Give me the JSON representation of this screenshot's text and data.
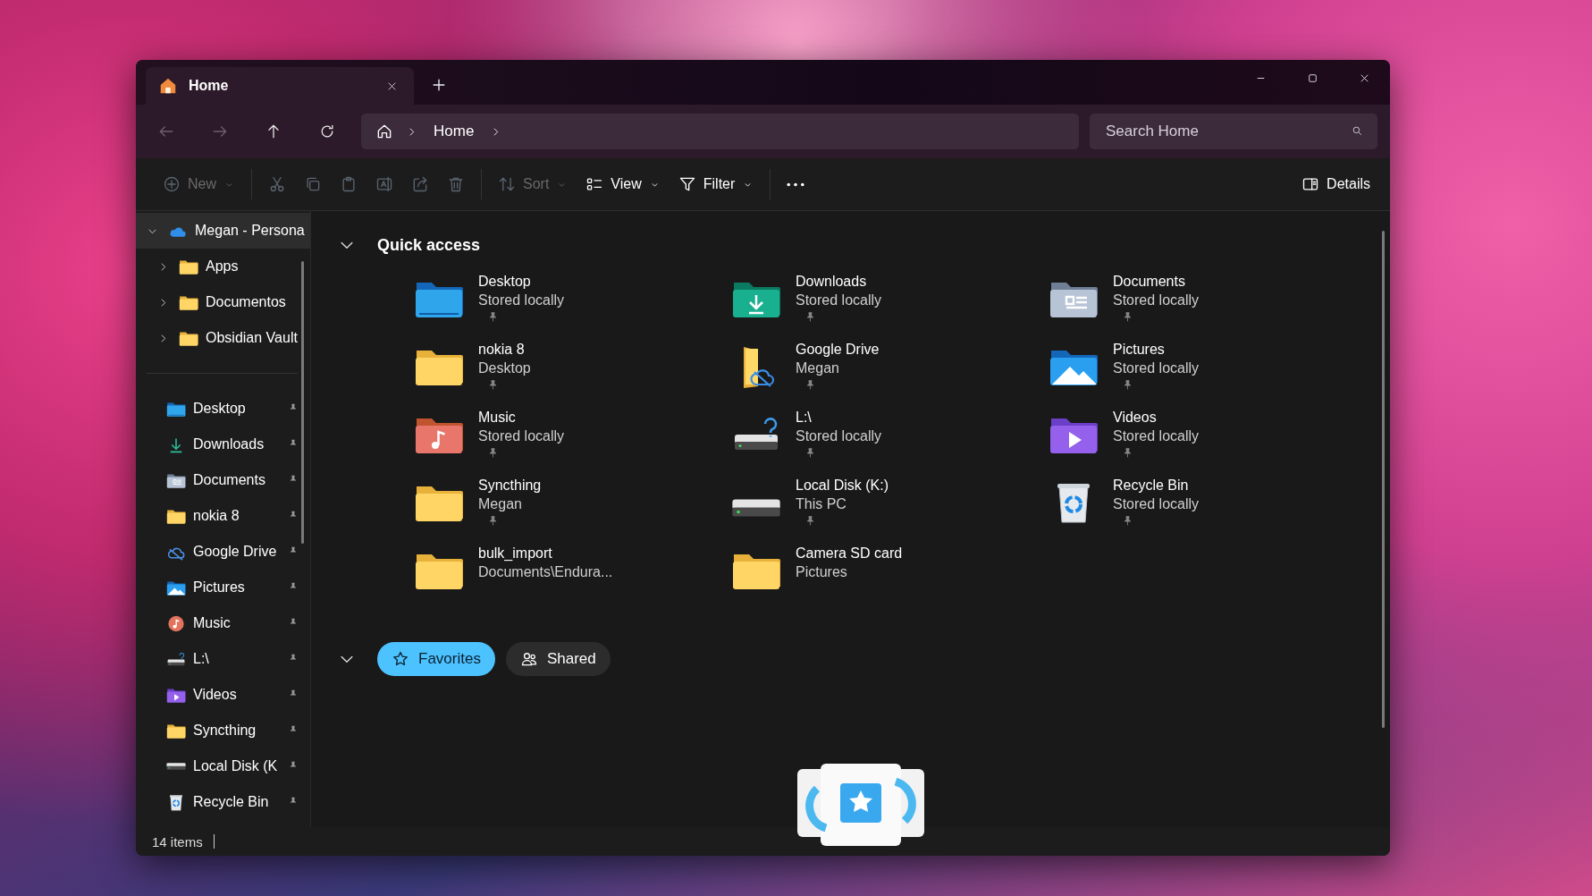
{
  "tabs": [
    {
      "title": "Home",
      "selected": true
    }
  ],
  "nav": [
    {
      "kind": "back",
      "disabled": true
    },
    {
      "kind": "forward",
      "disabled": true
    },
    {
      "kind": "up",
      "disabled": false
    },
    {
      "kind": "refresh",
      "disabled": false
    }
  ],
  "address_bar": {
    "crumbs": [
      "Home"
    ]
  },
  "search": {
    "placeholder": "Search Home"
  },
  "toolbar": {
    "items": [
      {
        "kind": "new",
        "label": "New",
        "disabled": true,
        "dropdown": true
      },
      {
        "kind": "cut",
        "disabled": true
      },
      {
        "kind": "copy",
        "disabled": true
      },
      {
        "kind": "paste",
        "disabled": true
      },
      {
        "kind": "rename",
        "disabled": true
      },
      {
        "kind": "share",
        "disabled": true
      },
      {
        "kind": "delete",
        "disabled": true
      },
      {
        "kind": "sort",
        "label": "Sort",
        "disabled": true,
        "dropdown": true
      },
      {
        "kind": "view",
        "label": "View",
        "disabled": false,
        "dropdown": true
      },
      {
        "kind": "filter",
        "label": "Filter",
        "disabled": false,
        "dropdown": true
      },
      {
        "kind": "more",
        "disabled": false
      }
    ],
    "details_button": {
      "label": "Details"
    }
  },
  "sidebar": {
    "tree": [
      {
        "label": "Megan - Persona",
        "kind": "cloud",
        "expanded": true,
        "selected": true,
        "children": [
          {
            "label": "Apps",
            "kind": "folder",
            "expanded": false,
            "selected": false
          },
          {
            "label": "Documentos",
            "kind": "folder",
            "expanded": false,
            "selected": false
          },
          {
            "label": "Obsidian Vault",
            "kind": "folder",
            "expanded": false,
            "selected": false
          }
        ]
      }
    ],
    "pinned": [
      {
        "label": "Desktop",
        "kind": "desktop"
      },
      {
        "label": "Downloads",
        "kind": "download-arrow"
      },
      {
        "label": "Documents",
        "kind": "documents"
      },
      {
        "label": "nokia 8",
        "kind": "folder"
      },
      {
        "label": "Google Drive",
        "kind": "cloud-outline"
      },
      {
        "label": "Pictures",
        "kind": "pictures"
      },
      {
        "label": "Music",
        "kind": "music-disc"
      },
      {
        "label": "L:\\",
        "kind": "drive-unknown"
      },
      {
        "label": "Videos",
        "kind": "videos"
      },
      {
        "label": "Syncthing",
        "kind": "folder"
      },
      {
        "label": "Local Disk (K",
        "kind": "drive"
      },
      {
        "label": "Recycle Bin",
        "kind": "recycle"
      }
    ]
  },
  "quick_access": {
    "title": "Quick access",
    "expanded": true,
    "items": [
      {
        "name": "Desktop",
        "location": "Stored locally",
        "kind": "desktop",
        "pinned": true
      },
      {
        "name": "Downloads",
        "location": "Stored locally",
        "kind": "downloads",
        "pinned": true
      },
      {
        "name": "Documents",
        "location": "Stored locally",
        "kind": "documents",
        "pinned": true
      },
      {
        "name": "nokia 8",
        "location": "Desktop",
        "kind": "folder",
        "pinned": true
      },
      {
        "name": "Google Drive",
        "location": "Megan",
        "kind": "cloud-folder",
        "pinned": true
      },
      {
        "name": "Pictures",
        "location": "Stored locally",
        "kind": "pictures",
        "pinned": true
      },
      {
        "name": "Music",
        "location": "Stored locally",
        "kind": "music",
        "pinned": true
      },
      {
        "name": "L:\\",
        "location": "Stored locally",
        "kind": "drive-unknown",
        "pinned": true
      },
      {
        "name": "Videos",
        "location": "Stored locally",
        "kind": "videos",
        "pinned": true
      },
      {
        "name": "Syncthing",
        "location": "Megan",
        "kind": "folder",
        "pinned": true
      },
      {
        "name": "Local Disk (K:)",
        "location": "This PC",
        "kind": "drive",
        "pinned": true
      },
      {
        "name": "Recycle Bin",
        "location": "Stored locally",
        "kind": "recycle",
        "pinned": true
      },
      {
        "name": "bulk_import",
        "location": "Documents\\Endura...",
        "kind": "folder",
        "pinned": false
      },
      {
        "name": "Camera SD card",
        "location": "Pictures",
        "kind": "folder",
        "pinned": false
      }
    ]
  },
  "favorites_section": {
    "expanded": true,
    "chips": [
      {
        "label": "Favorites",
        "kind": "star",
        "selected": true
      },
      {
        "label": "Shared",
        "kind": "people",
        "selected": false
      }
    ]
  },
  "status_bar": {
    "count": "14 items"
  }
}
